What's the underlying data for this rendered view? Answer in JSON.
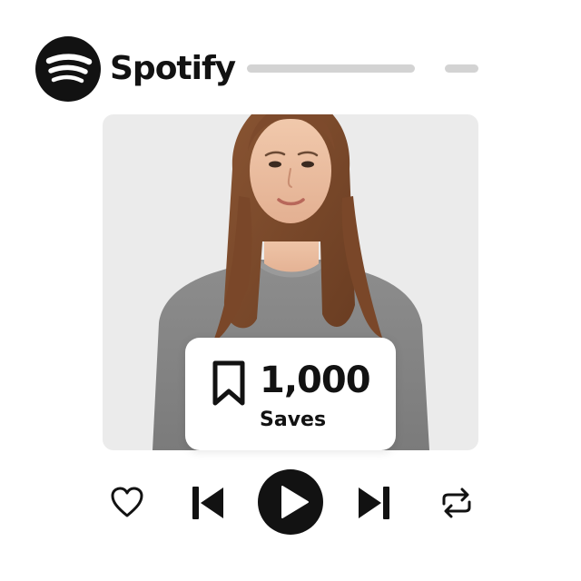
{
  "brand": {
    "name": "Spotify",
    "logo_icon": "spotify-logo-icon",
    "logo_color": "#121212"
  },
  "header": {
    "placeholder_bars": [
      "title-placeholder",
      "meta-placeholder"
    ]
  },
  "artwork": {
    "description_icon": "artist-photo",
    "background_color": "#ebebeb"
  },
  "badge": {
    "icon": "bookmark-icon",
    "count": "1,000",
    "label": "Saves"
  },
  "controls": {
    "items": [
      {
        "name": "like-button",
        "icon": "heart-icon"
      },
      {
        "name": "previous-button",
        "icon": "skip-back-icon"
      },
      {
        "name": "play-button",
        "icon": "play-icon"
      },
      {
        "name": "next-button",
        "icon": "skip-forward-icon"
      },
      {
        "name": "repeat-button",
        "icon": "repeat-icon"
      }
    ],
    "icon_color": "#121212"
  }
}
